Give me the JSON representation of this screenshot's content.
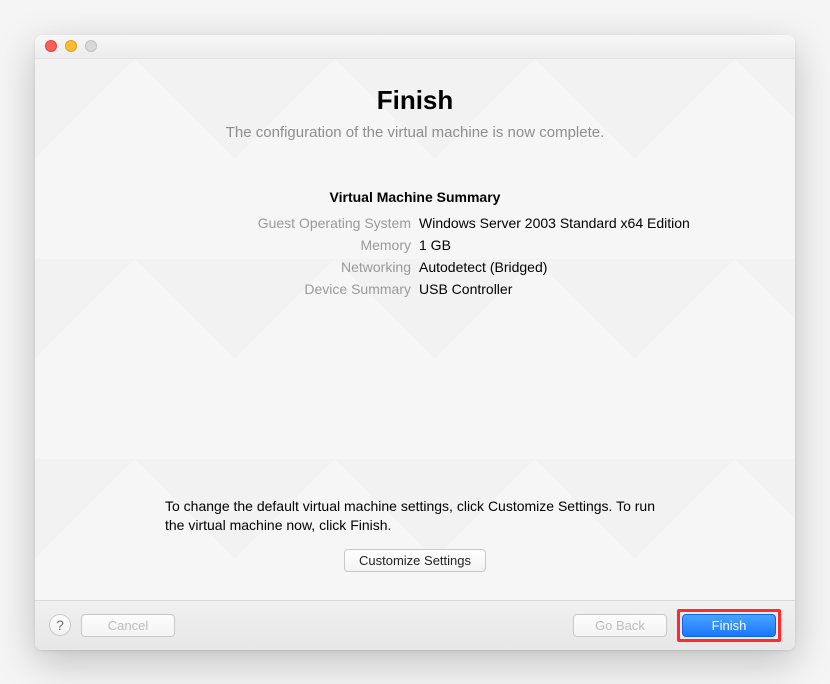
{
  "header": {
    "title": "Finish",
    "subtitle": "The configuration of the virtual machine is now complete."
  },
  "summary": {
    "title": "Virtual Machine Summary",
    "rows": [
      {
        "label": "Guest Operating System",
        "value": "Windows Server 2003 Standard x64 Edition"
      },
      {
        "label": "Memory",
        "value": "1 GB"
      },
      {
        "label": "Networking",
        "value": "Autodetect (Bridged)"
      },
      {
        "label": "Device Summary",
        "value": "USB Controller"
      }
    ]
  },
  "instruction": "To change the default virtual machine settings, click Customize Settings. To run the virtual machine now, click Finish.",
  "buttons": {
    "customize": "Customize Settings",
    "help": "?",
    "cancel": "Cancel",
    "goback": "Go Back",
    "finish": "Finish"
  }
}
